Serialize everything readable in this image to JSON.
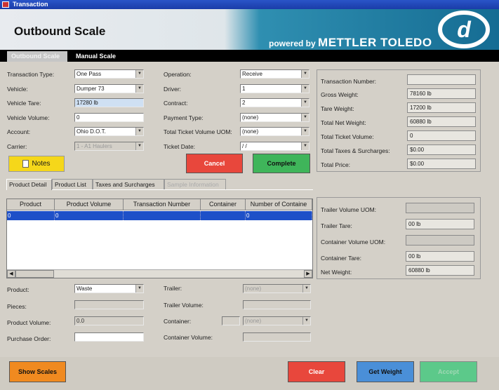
{
  "window": {
    "title": "Transaction"
  },
  "banner": {
    "heading": "Outbound Scale",
    "powered_by": "powered by",
    "brand": "METTLER TOLEDO"
  },
  "mode_tabs": [
    {
      "label": "Outbound Scale",
      "active": true
    },
    {
      "label": "Manual Scale",
      "active": false
    }
  ],
  "form": {
    "transaction_type": {
      "label": "Transaction Type:",
      "value": "One Pass"
    },
    "vehicle": {
      "label": "Vehicle:",
      "value": "Dumper 73"
    },
    "vehicle_tare": {
      "label": "Vehicle Tare:",
      "value": "17280 lb"
    },
    "vehicle_volume": {
      "label": "Vehicle Volume:",
      "value": "0"
    },
    "account": {
      "label": "Account:",
      "value": "Ohio D.O.T."
    },
    "carrier": {
      "label": "Carrier:",
      "value": "1 - A1 Haulers"
    },
    "operation": {
      "label": "Operation:",
      "value": "Receive"
    },
    "driver": {
      "label": "Driver:",
      "value": "1"
    },
    "contract": {
      "label": "Contract:",
      "value": "2"
    },
    "payment_type": {
      "label": "Payment Type:",
      "value": "(none)"
    },
    "total_ticket_volume_uom": {
      "label": "Total Ticket Volume UOM:",
      "value": "(none)"
    },
    "ticket_date": {
      "label": "Ticket Date:",
      "value": "/ /"
    }
  },
  "buttons": {
    "notes": "Notes",
    "cancel": "Cancel",
    "complete": "Complete",
    "show_scales": "Show Scales",
    "clear": "Clear",
    "get_weight": "Get Weight",
    "accept": "Accept"
  },
  "summary": {
    "transaction_number": {
      "label": "Transaction Number:",
      "value": ""
    },
    "gross_weight": {
      "label": "Gross Weight:",
      "value": "78160 lb"
    },
    "tare_weight": {
      "label": "Tare Weight:",
      "value": "17200 lb"
    },
    "total_net_weight": {
      "label": "Total Net Weight:",
      "value": "60880 lb"
    },
    "total_ticket_volume": {
      "label": "Total Ticket Volume:",
      "value": "0"
    },
    "total_taxes": {
      "label": "Total Taxes & Surcharges:",
      "value": "$0.00"
    },
    "total_price": {
      "label": "Total Price:",
      "value": "$0.00"
    }
  },
  "sub_tabs": [
    {
      "label": "Product Detail",
      "active": true,
      "enabled": true
    },
    {
      "label": "Product List",
      "active": false,
      "enabled": true
    },
    {
      "label": "Taxes and Surcharges",
      "active": false,
      "enabled": true
    },
    {
      "label": "Sample Information",
      "active": false,
      "enabled": false
    }
  ],
  "grid": {
    "columns": [
      "Product",
      "Product Volume",
      "Transaction Number",
      "Container",
      "Number of Containe"
    ],
    "rows": [
      [
        "0",
        "0",
        "",
        "",
        "0"
      ]
    ]
  },
  "product": {
    "product": {
      "label": "Product:",
      "value": "Waste"
    },
    "pieces": {
      "label": "Pieces:",
      "value": ""
    },
    "product_volume": {
      "label": "Product Volume:",
      "value": "0.0"
    },
    "purchase_order": {
      "label": "Purchase Order:",
      "value": ""
    },
    "trailer": {
      "label": "Trailer:",
      "value": "(none)"
    },
    "trailer_volume": {
      "label": "Trailer Volume:",
      "value": ""
    },
    "container": {
      "label": "Container:",
      "value": "(none)"
    },
    "container_volume": {
      "label": "Container Volume:",
      "value": ""
    }
  },
  "right_panel": {
    "trailer_volume_uom": {
      "label": "Trailer Volume UOM:",
      "value": ""
    },
    "trailer_tare": {
      "label": "Trailer Tare:",
      "value": "00 lb"
    },
    "container_volume_uom": {
      "label": "Container Volume UOM:",
      "value": ""
    },
    "container_tare": {
      "label": "Container Tare:",
      "value": "00 lb"
    },
    "net_weight": {
      "label": "Net Weight:",
      "value": "60880 lb"
    }
  },
  "colors": {
    "cancel": "#e8473c",
    "complete": "#3fb55a",
    "get_weight": "#4a8fd8",
    "accept": "#5cc98a",
    "clear": "#e8473c",
    "show_scales": "#f08a20",
    "notes": "#f5d71a"
  }
}
